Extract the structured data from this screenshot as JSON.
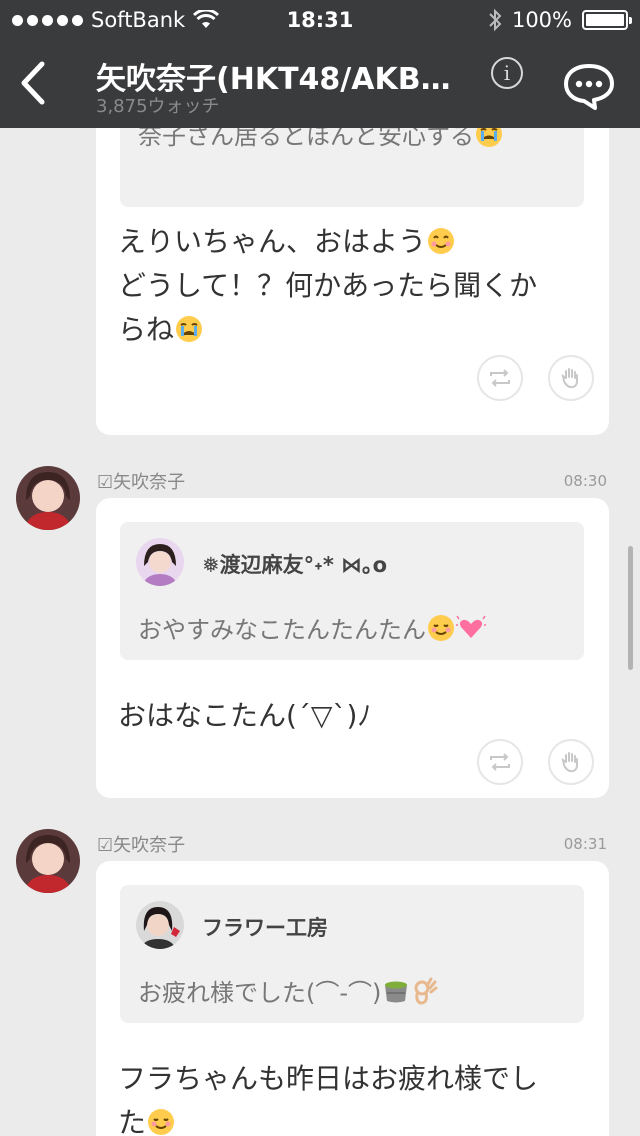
{
  "status_bar": {
    "carrier": "SoftBank",
    "time": "18:31",
    "battery": "100%"
  },
  "nav": {
    "title": "矢吹奈子(HKT48/AKB4…",
    "subtitle": "3,875ウォッチ",
    "info_glyph": "i"
  },
  "posts": [
    {
      "quote_text_partial": "奈子さん居るとほんと安心する",
      "message_lines": [
        "えりいちゃん、おはよう",
        "どうして！？何かあったら聞くか",
        "らね"
      ]
    },
    {
      "poster": "☑矢吹奈子",
      "time": "08:30",
      "quote_name": "❅渡辺麻友°˖* ⋈｡o",
      "quote_text": "おやすみなこたんたんたん",
      "message_lines": [
        "おはなこたん(´▽`)ﾉ"
      ]
    },
    {
      "poster": "☑矢吹奈子",
      "time": "08:31",
      "quote_name": "フラワー工房",
      "quote_text": "お疲れ様でした(⌒-⌒)",
      "message_lines": [
        "フラちゃんも昨日はお疲れ様でし",
        "た"
      ]
    }
  ],
  "colors": {
    "nav_bg": "#3a3b3d",
    "feed_bg": "#ebebeb",
    "card_bg": "#ffffff",
    "quote_bg": "#f0f0f0"
  },
  "icons": [
    "wifi-icon",
    "bluetooth-icon",
    "battery-icon",
    "back-chevron-icon",
    "info-icon",
    "chat-bubble-icon",
    "retweet-icon",
    "hand-icon"
  ]
}
